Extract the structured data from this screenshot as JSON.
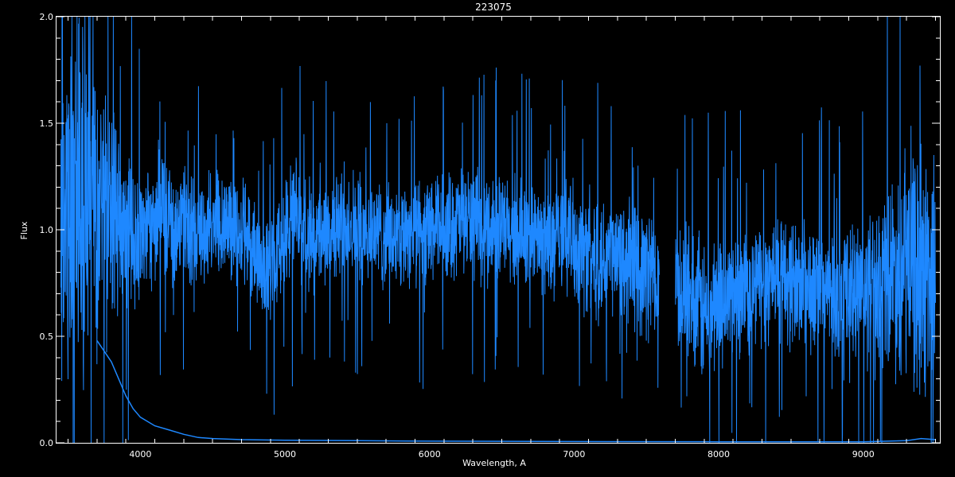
{
  "chart_data": {
    "type": "line",
    "title": "223075",
    "xlabel": "Wavelength, A",
    "ylabel": "Flux",
    "xlim": [
      3420,
      9530
    ],
    "ylim": [
      0,
      2
    ],
    "xticks": [
      4000,
      5000,
      6000,
      7000,
      8000,
      9000
    ],
    "yticks": [
      0.0,
      0.5,
      1.0,
      1.5,
      2.0
    ],
    "xtick_labels": [
      "4000",
      "5000",
      "6000",
      "7000",
      "8000",
      "9000"
    ],
    "ytick_labels": [
      "0.0",
      "0.5",
      "1.0",
      "1.5",
      "2.0"
    ],
    "grid": false,
    "background": "#000000",
    "axis_color": "#ffffff",
    "series": [
      {
        "color": "#1e88ff",
        "gaps": [
          [
            7590,
            7700
          ]
        ],
        "x": [
          3450,
          3550,
          3650,
          3750,
          3850,
          3950,
          4050,
          4150,
          4250,
          4350,
          4450,
          4550,
          4650,
          4750,
          4850,
          4950,
          5050,
          5150,
          5250,
          5350,
          5450,
          5550,
          5650,
          5750,
          5850,
          5950,
          6050,
          6150,
          6250,
          6350,
          6450,
          6550,
          6650,
          6750,
          6850,
          6950,
          7050,
          7150,
          7250,
          7350,
          7450,
          7550,
          7700,
          7800,
          7900,
          8000,
          8100,
          8200,
          8300,
          8400,
          8500,
          8600,
          8700,
          8800,
          8900,
          9000,
          9100,
          9200,
          9300,
          9400,
          9500
        ],
        "y": [
          1.1,
          1.15,
          1.12,
          1.05,
          1.0,
          0.98,
          1.02,
          1.08,
          1.0,
          1.02,
          1.0,
          1.05,
          1.02,
          0.95,
          0.8,
          0.9,
          1.05,
          1.0,
          0.95,
          1.0,
          1.05,
          1.0,
          0.98,
          0.95,
          1.0,
          0.98,
          1.0,
          1.02,
          1.05,
          1.0,
          1.02,
          0.98,
          1.0,
          0.95,
          0.92,
          0.98,
          0.9,
          0.88,
          0.88,
          0.85,
          0.8,
          0.8,
          0.75,
          0.7,
          0.6,
          0.68,
          0.7,
          0.72,
          0.75,
          0.8,
          0.75,
          0.72,
          0.7,
          0.7,
          0.72,
          0.7,
          0.75,
          0.8,
          0.85,
          0.8,
          0.82
        ],
        "noise": [
          0.9,
          0.85,
          0.8,
          0.6,
          0.45,
          0.4,
          0.3,
          0.3,
          0.25,
          0.25,
          0.25,
          0.25,
          0.28,
          0.25,
          0.25,
          0.25,
          0.28,
          0.25,
          0.25,
          0.25,
          0.25,
          0.25,
          0.25,
          0.25,
          0.25,
          0.25,
          0.25,
          0.25,
          0.25,
          0.25,
          0.25,
          0.25,
          0.25,
          0.25,
          0.25,
          0.25,
          0.3,
          0.3,
          0.3,
          0.3,
          0.3,
          0.3,
          0.3,
          0.3,
          0.35,
          0.3,
          0.3,
          0.3,
          0.3,
          0.3,
          0.3,
          0.3,
          0.3,
          0.3,
          0.3,
          0.35,
          0.4,
          0.45,
          0.55,
          0.6,
          0.55
        ]
      },
      {
        "color": "#1e88ff",
        "x": [
          3700,
          3750,
          3800,
          3850,
          3900,
          3950,
          4000,
          4100,
          4200,
          4300,
          4400,
          4500,
          4700,
          5000,
          5500,
          6000,
          7000,
          8000,
          9000,
          9300,
          9400,
          9500
        ],
        "y": [
          0.48,
          0.43,
          0.38,
          0.3,
          0.22,
          0.16,
          0.12,
          0.08,
          0.06,
          0.04,
          0.025,
          0.02,
          0.015,
          0.012,
          0.01,
          0.008,
          0.006,
          0.005,
          0.005,
          0.01,
          0.02,
          0.015
        ]
      }
    ]
  }
}
